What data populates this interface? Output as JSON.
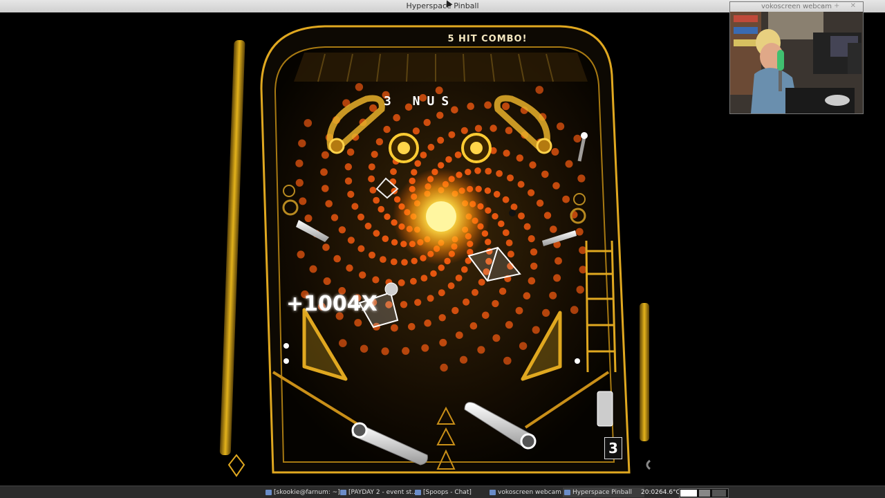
{
  "window": {
    "title": "Hyperspace Pinball"
  },
  "hud": {
    "combo_text": "5 HIT COMBO!",
    "bonus_letters": "3 NUS",
    "score_popup": "+1004X",
    "balls_remaining": "3"
  },
  "webcam": {
    "title": "vokoscreen webcam",
    "controls": "– + ✕"
  },
  "taskbar": {
    "tasks": [
      {
        "label": "[skookie@farnum: ~]",
        "icon": "terminal-icon"
      },
      {
        "label": "[PAYDAY 2 - event st...",
        "icon": "steam-icon"
      },
      {
        "label": "[Spoops - Chat]",
        "icon": "steam-icon"
      },
      {
        "label": "vokoscreen webcam",
        "icon": "webcam-icon"
      },
      {
        "label": "Hyperspace Pinball",
        "icon": "game-icon"
      }
    ],
    "clock": "20:02",
    "temperature": "64.6°C"
  },
  "colors": {
    "accent": "#f2b418",
    "spiral": "#ff6a12",
    "sun": "#fff27a"
  }
}
